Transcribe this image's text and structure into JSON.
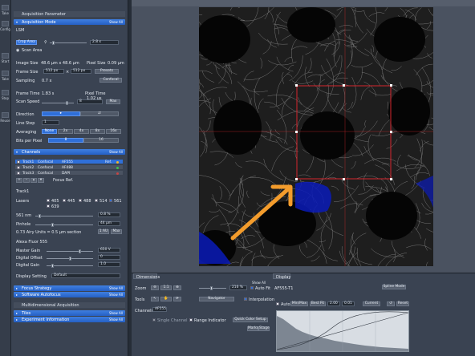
{
  "left_strip": {
    "items": [
      "Take",
      "Config",
      "Start",
      "Take",
      "Stop",
      "Reuse"
    ]
  },
  "acquisition": {
    "section_title": "Acquisition Parameter",
    "acq_mode": {
      "title": "Acquisition Mode",
      "show_all": "Show All"
    },
    "lsm_label": "LSM",
    "crop_area": "Crop Area",
    "zoom_value": "2.8 x",
    "scan_area": "Scan Area",
    "image_size_label": "Image Size",
    "image_size_value": "48.6 µm x 48.6 µm",
    "pixel_size_label": "Pixel Size",
    "pixel_size_value": "0.09 µm",
    "frame_size_label": "Frame Size",
    "frame_size_x": "512 px",
    "frame_size_y": "512 px",
    "frame_size_preset": "Presets",
    "sampling_label": "Sampling",
    "sampling_value": "0.7 x",
    "confocal_btn": "Confocal",
    "frame_time_label": "Frame Time",
    "frame_time_value": "1.83 s",
    "pixel_time_label": "Pixel Time",
    "pixel_time_value": "1.02 µs",
    "scan_speed_label": "Scan Speed",
    "scan_speed_value": "8",
    "max_btn": "Max",
    "direction_label": "Direction",
    "line_step_label": "Line Step",
    "line_step_value": "1",
    "averaging_label": "Averaging",
    "averaging_options": [
      "None",
      "2x",
      "4x",
      "8x",
      "16x"
    ],
    "bits_label": "Bits per Pixel",
    "bits_options": [
      "8",
      "16"
    ]
  },
  "channels": {
    "title": "Channels",
    "show_all": "Show All",
    "tracks": [
      {
        "name": "Track1",
        "mode": "Confocal",
        "dye": "AF555",
        "ref": "Ref.",
        "color": "#f3b52b"
      },
      {
        "name": "Track2",
        "mode": "Confocal",
        "dye": "AF488",
        "ref": "",
        "color": "#3fc14a"
      },
      {
        "name": "Track3",
        "mode": "Confocal",
        "dye": "DAPI",
        "ref": "",
        "color": "#c64545"
      }
    ],
    "focus_ref": "Focus Ref.",
    "track_heading": "Track1",
    "lasers_label": "Lasers",
    "lasers": [
      "405",
      "445",
      "488",
      "514",
      "561",
      "639"
    ],
    "laser_line": "561 nm",
    "laser_power": "0.8 %",
    "pinhole_label": "Pinhole",
    "pinhole_value": "44 µm",
    "airy_text": "0.73 Airy Units = 0.5 µm section",
    "pinhole_1au": "1 AU",
    "pinhole_max": "Max",
    "dye_title": "Alexa Fluor 555",
    "master_gain_label": "Master Gain",
    "master_gain_value": "650 V",
    "digital_offset_label": "Digital Offset",
    "digital_offset_value": "0",
    "digital_gain_label": "Digital Gain",
    "digital_gain_value": "1.0",
    "display_setting_label": "Display Setting",
    "display_setting_value": "Default"
  },
  "lower_sections": {
    "focus_strategy": {
      "title": "Focus Strategy",
      "show_all": "Show All"
    },
    "software_autofocus": {
      "title": "Software Autofocus",
      "show_all": "Show All"
    },
    "multidimensional": "Multidimensional Acquisition",
    "tiles": {
      "title": "Tiles",
      "show_all": "Show All"
    },
    "experiment_info": {
      "title": "Experiment Information",
      "show_all": "Show All"
    }
  },
  "bottom": {
    "tab_dimensions": "Dimensions",
    "show_all": "Show All",
    "tab_display": "Display",
    "zoom_label": "Zoom",
    "zoom_value": "216 %",
    "auto_fit": "Auto Fit",
    "tools_label": "Tools",
    "navigator": "Navigator",
    "interpolation": "Interpolation",
    "channels_label": "Channels",
    "channel_name": "AF555",
    "single_channel": "Single Channel",
    "range_indicator": "Range Indicator",
    "quick_color": "Quick Color Setup",
    "marks": "Marks",
    "stage": "Stage",
    "display_channel": "AF555-T1",
    "spline_mode": "Spline Mode",
    "auto": "Auto",
    "min_max": "Min/Max",
    "best_fit": "Best Fit",
    "gamma": "2.00",
    "offset": "0.01",
    "current": "Current",
    "reset": "Reset"
  },
  "colors": {
    "accent": "#2f6fd8",
    "roi": "#d6262d",
    "arrow": "#f39c2c"
  }
}
